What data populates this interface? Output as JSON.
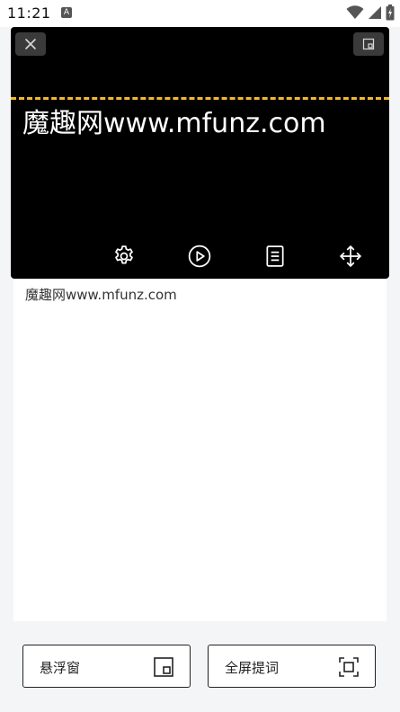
{
  "status_bar": {
    "time": "11:21",
    "app_icon_letter": "A"
  },
  "floating_window": {
    "prompter_text": "魔趣网www.mfunz.com",
    "controls": [
      "settings-icon",
      "play-icon",
      "document-icon",
      "move-icon"
    ],
    "guide_color": "#f2b92f"
  },
  "main": {
    "script_text": "魔趣网www.mfunz.com"
  },
  "buttons": {
    "float_label": "悬浮窗",
    "fullscreen_label": "全屏提词"
  },
  "colors": {
    "background": "#f4f5f7",
    "card": "#ffffff",
    "window": "#000000"
  }
}
